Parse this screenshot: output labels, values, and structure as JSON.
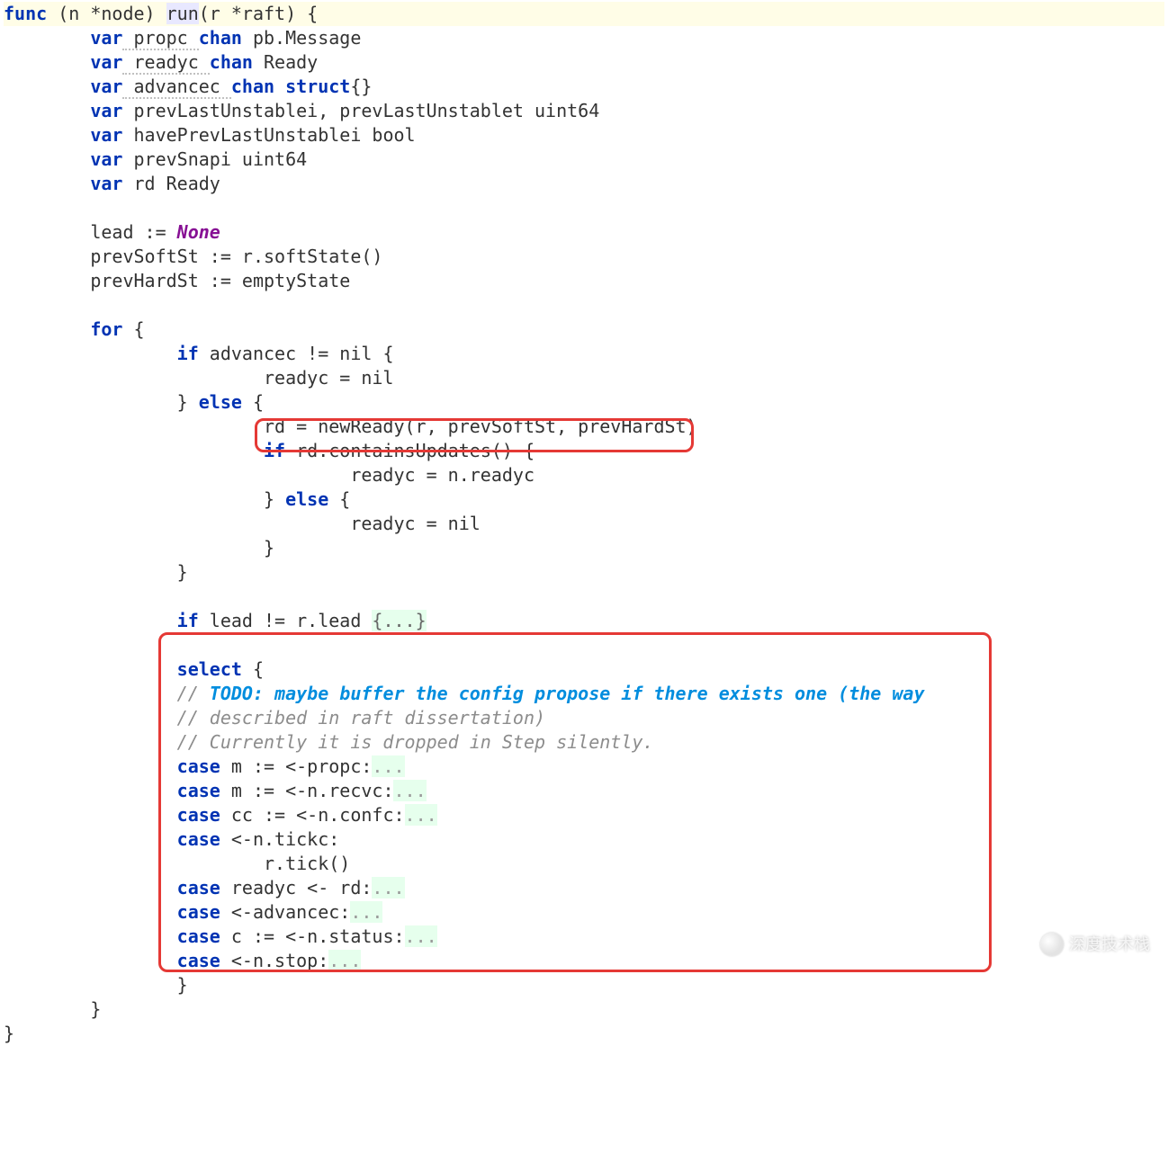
{
  "code": {
    "l1_func": "func",
    "l1_recv": " (n *node) ",
    "l1_run": "run",
    "l1_sig": "(r *raft) {",
    "l2_var": "var",
    "l2_name": " propc ",
    "l2_chan": "chan",
    "l2_type": " pb.Message",
    "l3_var": "var",
    "l3_name": " readyc ",
    "l3_chan": "chan",
    "l3_type": " Ready",
    "l4_var": "var",
    "l4_name": " advancec ",
    "l4_chan": "chan",
    "l4_struct": " struct",
    "l4_braces": "{}",
    "l5_var": "var",
    "l5_rest": " prevLastUnstablei, prevLastUnstablet uint64",
    "l6_var": "var",
    "l6_rest": " havePrevLastUnstablei bool",
    "l7_var": "var",
    "l7_rest": " prevSnapi uint64",
    "l8_var": "var",
    "l8_rest": " rd Ready",
    "l10_a": "lead := ",
    "l10_none": "None",
    "l11": "prevSoftSt := r.softState()",
    "l12": "prevHardSt := emptyState",
    "l14_for": "for",
    "l14_brace": " {",
    "l15_if": "if",
    "l15_rest": " advancec != nil {",
    "l16": "readyc = nil",
    "l17_a": "} ",
    "l17_else": "else",
    "l17_b": " {",
    "l18": "rd = newReady(r, prevSoftSt, prevHardSt)",
    "l19_if": "if",
    "l19_rest": " rd.containsUpdates() {",
    "l20": "readyc = n.readyc",
    "l21_a": "} ",
    "l21_else": "else",
    "l21_b": " {",
    "l22": "readyc = nil",
    "l23": "}",
    "l24": "}",
    "l26_if": "if",
    "l26_rest": " lead != r.lead ",
    "l26_fold": "{...}",
    "l28_select": "select",
    "l28_brace": " {",
    "l29_a": "// ",
    "l29_todo": "TODO: maybe buffer the config propose if there exists one (the way",
    "l30": "// described in raft dissertation)",
    "l31": "// Currently it is dropped in Step silently.",
    "l32_case": "case",
    "l32_rest": " m := <-propc:",
    "l32_fold": "...",
    "l33_case": "case",
    "l33_rest": " m := <-n.recvc:",
    "l33_fold": "...",
    "l34_case": "case",
    "l34_rest": " cc := <-n.confc:",
    "l34_fold": "...",
    "l35_case": "case",
    "l35_rest": " <-n.tickc:",
    "l36": "r.tick()",
    "l37_case": "case",
    "l37_rest": " readyc <- rd:",
    "l37_fold": "...",
    "l38_case": "case",
    "l38_rest": " <-advancec:",
    "l38_fold": "...",
    "l39_case": "case",
    "l39_rest": " c := <-n.status:",
    "l39_fold": "...",
    "l40_case": "case",
    "l40_rest": " <-n.stop:",
    "l40_fold": "...",
    "l41": "}",
    "l42": "}",
    "l43": "}"
  },
  "watermark": "深度技术栈"
}
